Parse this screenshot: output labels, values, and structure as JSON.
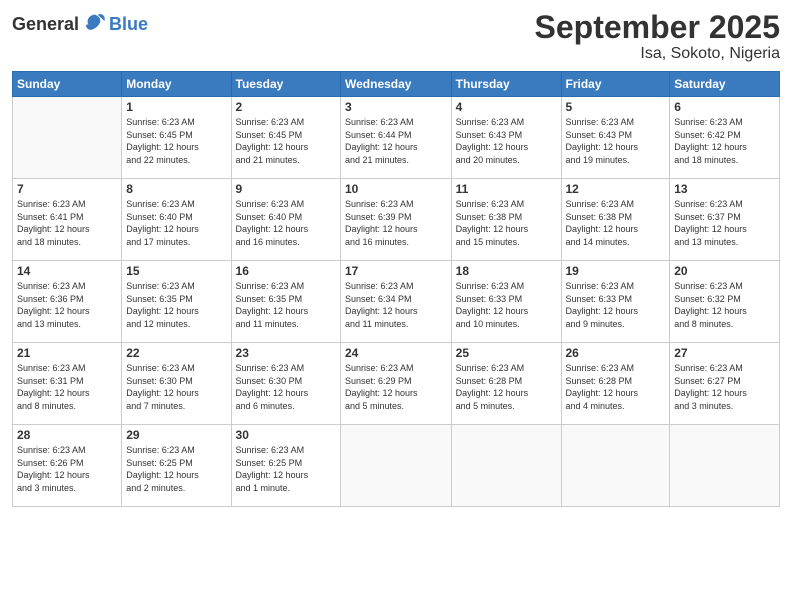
{
  "header": {
    "logo_general": "General",
    "logo_blue": "Blue",
    "title": "September 2025",
    "subtitle": "Isa, Sokoto, Nigeria"
  },
  "days_of_week": [
    "Sunday",
    "Monday",
    "Tuesday",
    "Wednesday",
    "Thursday",
    "Friday",
    "Saturday"
  ],
  "weeks": [
    [
      {
        "day": "",
        "sunrise": "",
        "sunset": "",
        "daylight": "",
        "empty": true
      },
      {
        "day": "1",
        "sunrise": "Sunrise: 6:23 AM",
        "sunset": "Sunset: 6:45 PM",
        "daylight": "Daylight: 12 hours and 22 minutes."
      },
      {
        "day": "2",
        "sunrise": "Sunrise: 6:23 AM",
        "sunset": "Sunset: 6:45 PM",
        "daylight": "Daylight: 12 hours and 21 minutes."
      },
      {
        "day": "3",
        "sunrise": "Sunrise: 6:23 AM",
        "sunset": "Sunset: 6:44 PM",
        "daylight": "Daylight: 12 hours and 21 minutes."
      },
      {
        "day": "4",
        "sunrise": "Sunrise: 6:23 AM",
        "sunset": "Sunset: 6:43 PM",
        "daylight": "Daylight: 12 hours and 20 minutes."
      },
      {
        "day": "5",
        "sunrise": "Sunrise: 6:23 AM",
        "sunset": "Sunset: 6:43 PM",
        "daylight": "Daylight: 12 hours and 19 minutes."
      },
      {
        "day": "6",
        "sunrise": "Sunrise: 6:23 AM",
        "sunset": "Sunset: 6:42 PM",
        "daylight": "Daylight: 12 hours and 18 minutes."
      }
    ],
    [
      {
        "day": "7",
        "sunrise": "Sunrise: 6:23 AM",
        "sunset": "Sunset: 6:41 PM",
        "daylight": "Daylight: 12 hours and 18 minutes."
      },
      {
        "day": "8",
        "sunrise": "Sunrise: 6:23 AM",
        "sunset": "Sunset: 6:40 PM",
        "daylight": "Daylight: 12 hours and 17 minutes."
      },
      {
        "day": "9",
        "sunrise": "Sunrise: 6:23 AM",
        "sunset": "Sunset: 6:40 PM",
        "daylight": "Daylight: 12 hours and 16 minutes."
      },
      {
        "day": "10",
        "sunrise": "Sunrise: 6:23 AM",
        "sunset": "Sunset: 6:39 PM",
        "daylight": "Daylight: 12 hours and 16 minutes."
      },
      {
        "day": "11",
        "sunrise": "Sunrise: 6:23 AM",
        "sunset": "Sunset: 6:38 PM",
        "daylight": "Daylight: 12 hours and 15 minutes."
      },
      {
        "day": "12",
        "sunrise": "Sunrise: 6:23 AM",
        "sunset": "Sunset: 6:38 PM",
        "daylight": "Daylight: 12 hours and 14 minutes."
      },
      {
        "day": "13",
        "sunrise": "Sunrise: 6:23 AM",
        "sunset": "Sunset: 6:37 PM",
        "daylight": "Daylight: 12 hours and 13 minutes."
      }
    ],
    [
      {
        "day": "14",
        "sunrise": "Sunrise: 6:23 AM",
        "sunset": "Sunset: 6:36 PM",
        "daylight": "Daylight: 12 hours and 13 minutes."
      },
      {
        "day": "15",
        "sunrise": "Sunrise: 6:23 AM",
        "sunset": "Sunset: 6:35 PM",
        "daylight": "Daylight: 12 hours and 12 minutes."
      },
      {
        "day": "16",
        "sunrise": "Sunrise: 6:23 AM",
        "sunset": "Sunset: 6:35 PM",
        "daylight": "Daylight: 12 hours and 11 minutes."
      },
      {
        "day": "17",
        "sunrise": "Sunrise: 6:23 AM",
        "sunset": "Sunset: 6:34 PM",
        "daylight": "Daylight: 12 hours and 11 minutes."
      },
      {
        "day": "18",
        "sunrise": "Sunrise: 6:23 AM",
        "sunset": "Sunset: 6:33 PM",
        "daylight": "Daylight: 12 hours and 10 minutes."
      },
      {
        "day": "19",
        "sunrise": "Sunrise: 6:23 AM",
        "sunset": "Sunset: 6:33 PM",
        "daylight": "Daylight: 12 hours and 9 minutes."
      },
      {
        "day": "20",
        "sunrise": "Sunrise: 6:23 AM",
        "sunset": "Sunset: 6:32 PM",
        "daylight": "Daylight: 12 hours and 8 minutes."
      }
    ],
    [
      {
        "day": "21",
        "sunrise": "Sunrise: 6:23 AM",
        "sunset": "Sunset: 6:31 PM",
        "daylight": "Daylight: 12 hours and 8 minutes."
      },
      {
        "day": "22",
        "sunrise": "Sunrise: 6:23 AM",
        "sunset": "Sunset: 6:30 PM",
        "daylight": "Daylight: 12 hours and 7 minutes."
      },
      {
        "day": "23",
        "sunrise": "Sunrise: 6:23 AM",
        "sunset": "Sunset: 6:30 PM",
        "daylight": "Daylight: 12 hours and 6 minutes."
      },
      {
        "day": "24",
        "sunrise": "Sunrise: 6:23 AM",
        "sunset": "Sunset: 6:29 PM",
        "daylight": "Daylight: 12 hours and 5 minutes."
      },
      {
        "day": "25",
        "sunrise": "Sunrise: 6:23 AM",
        "sunset": "Sunset: 6:28 PM",
        "daylight": "Daylight: 12 hours and 5 minutes."
      },
      {
        "day": "26",
        "sunrise": "Sunrise: 6:23 AM",
        "sunset": "Sunset: 6:28 PM",
        "daylight": "Daylight: 12 hours and 4 minutes."
      },
      {
        "day": "27",
        "sunrise": "Sunrise: 6:23 AM",
        "sunset": "Sunset: 6:27 PM",
        "daylight": "Daylight: 12 hours and 3 minutes."
      }
    ],
    [
      {
        "day": "28",
        "sunrise": "Sunrise: 6:23 AM",
        "sunset": "Sunset: 6:26 PM",
        "daylight": "Daylight: 12 hours and 3 minutes."
      },
      {
        "day": "29",
        "sunrise": "Sunrise: 6:23 AM",
        "sunset": "Sunset: 6:25 PM",
        "daylight": "Daylight: 12 hours and 2 minutes."
      },
      {
        "day": "30",
        "sunrise": "Sunrise: 6:23 AM",
        "sunset": "Sunset: 6:25 PM",
        "daylight": "Daylight: 12 hours and 1 minute."
      },
      {
        "day": "",
        "sunrise": "",
        "sunset": "",
        "daylight": "",
        "empty": true
      },
      {
        "day": "",
        "sunrise": "",
        "sunset": "",
        "daylight": "",
        "empty": true
      },
      {
        "day": "",
        "sunrise": "",
        "sunset": "",
        "daylight": "",
        "empty": true
      },
      {
        "day": "",
        "sunrise": "",
        "sunset": "",
        "daylight": "",
        "empty": true
      }
    ]
  ]
}
